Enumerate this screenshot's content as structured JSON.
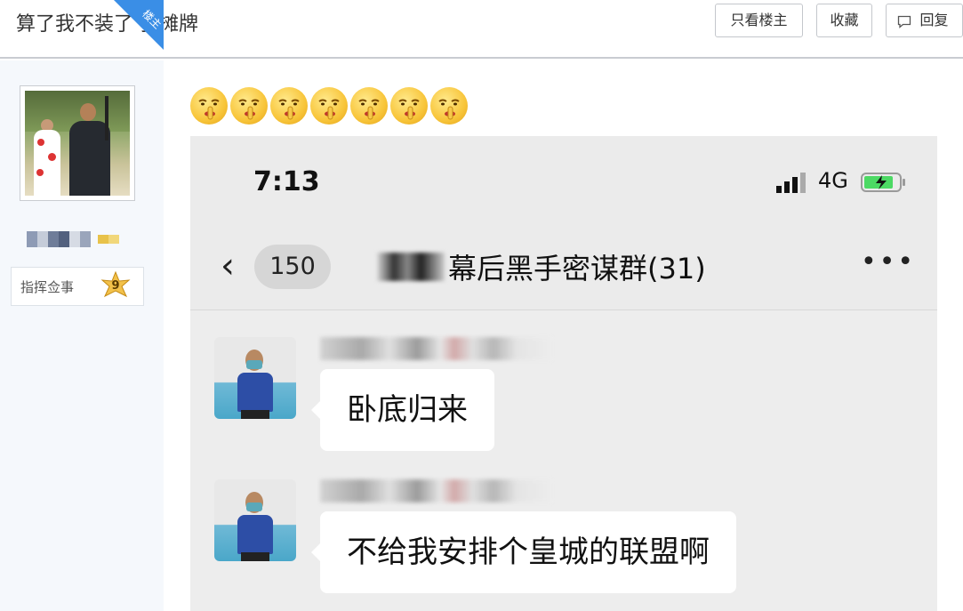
{
  "header": {
    "title": "算了我不装了 我摊牌",
    "buttons": {
      "only_op": "只看楼主",
      "favorite": "收藏",
      "reply": "回复"
    }
  },
  "sidebar": {
    "corner_badge": "楼主",
    "rank_label": "指挥佥事",
    "level": "9"
  },
  "post": {
    "emoji_count": 7,
    "emoji_name": "嘘-emoji",
    "screenshot": {
      "time": "7:13",
      "network": "4G",
      "unread_count": "150",
      "group_name": "幕后黑手密谋群(31)",
      "more_icon": "•••",
      "back_icon": "‹",
      "messages": [
        {
          "text": "卧底归来"
        },
        {
          "text": "不给我安排个皇城的联盟啊"
        }
      ]
    }
  },
  "colors": {
    "accent": "#3a8ee6",
    "sidebar_bg": "#f5f8fc",
    "phone_bg": "#ededed"
  }
}
